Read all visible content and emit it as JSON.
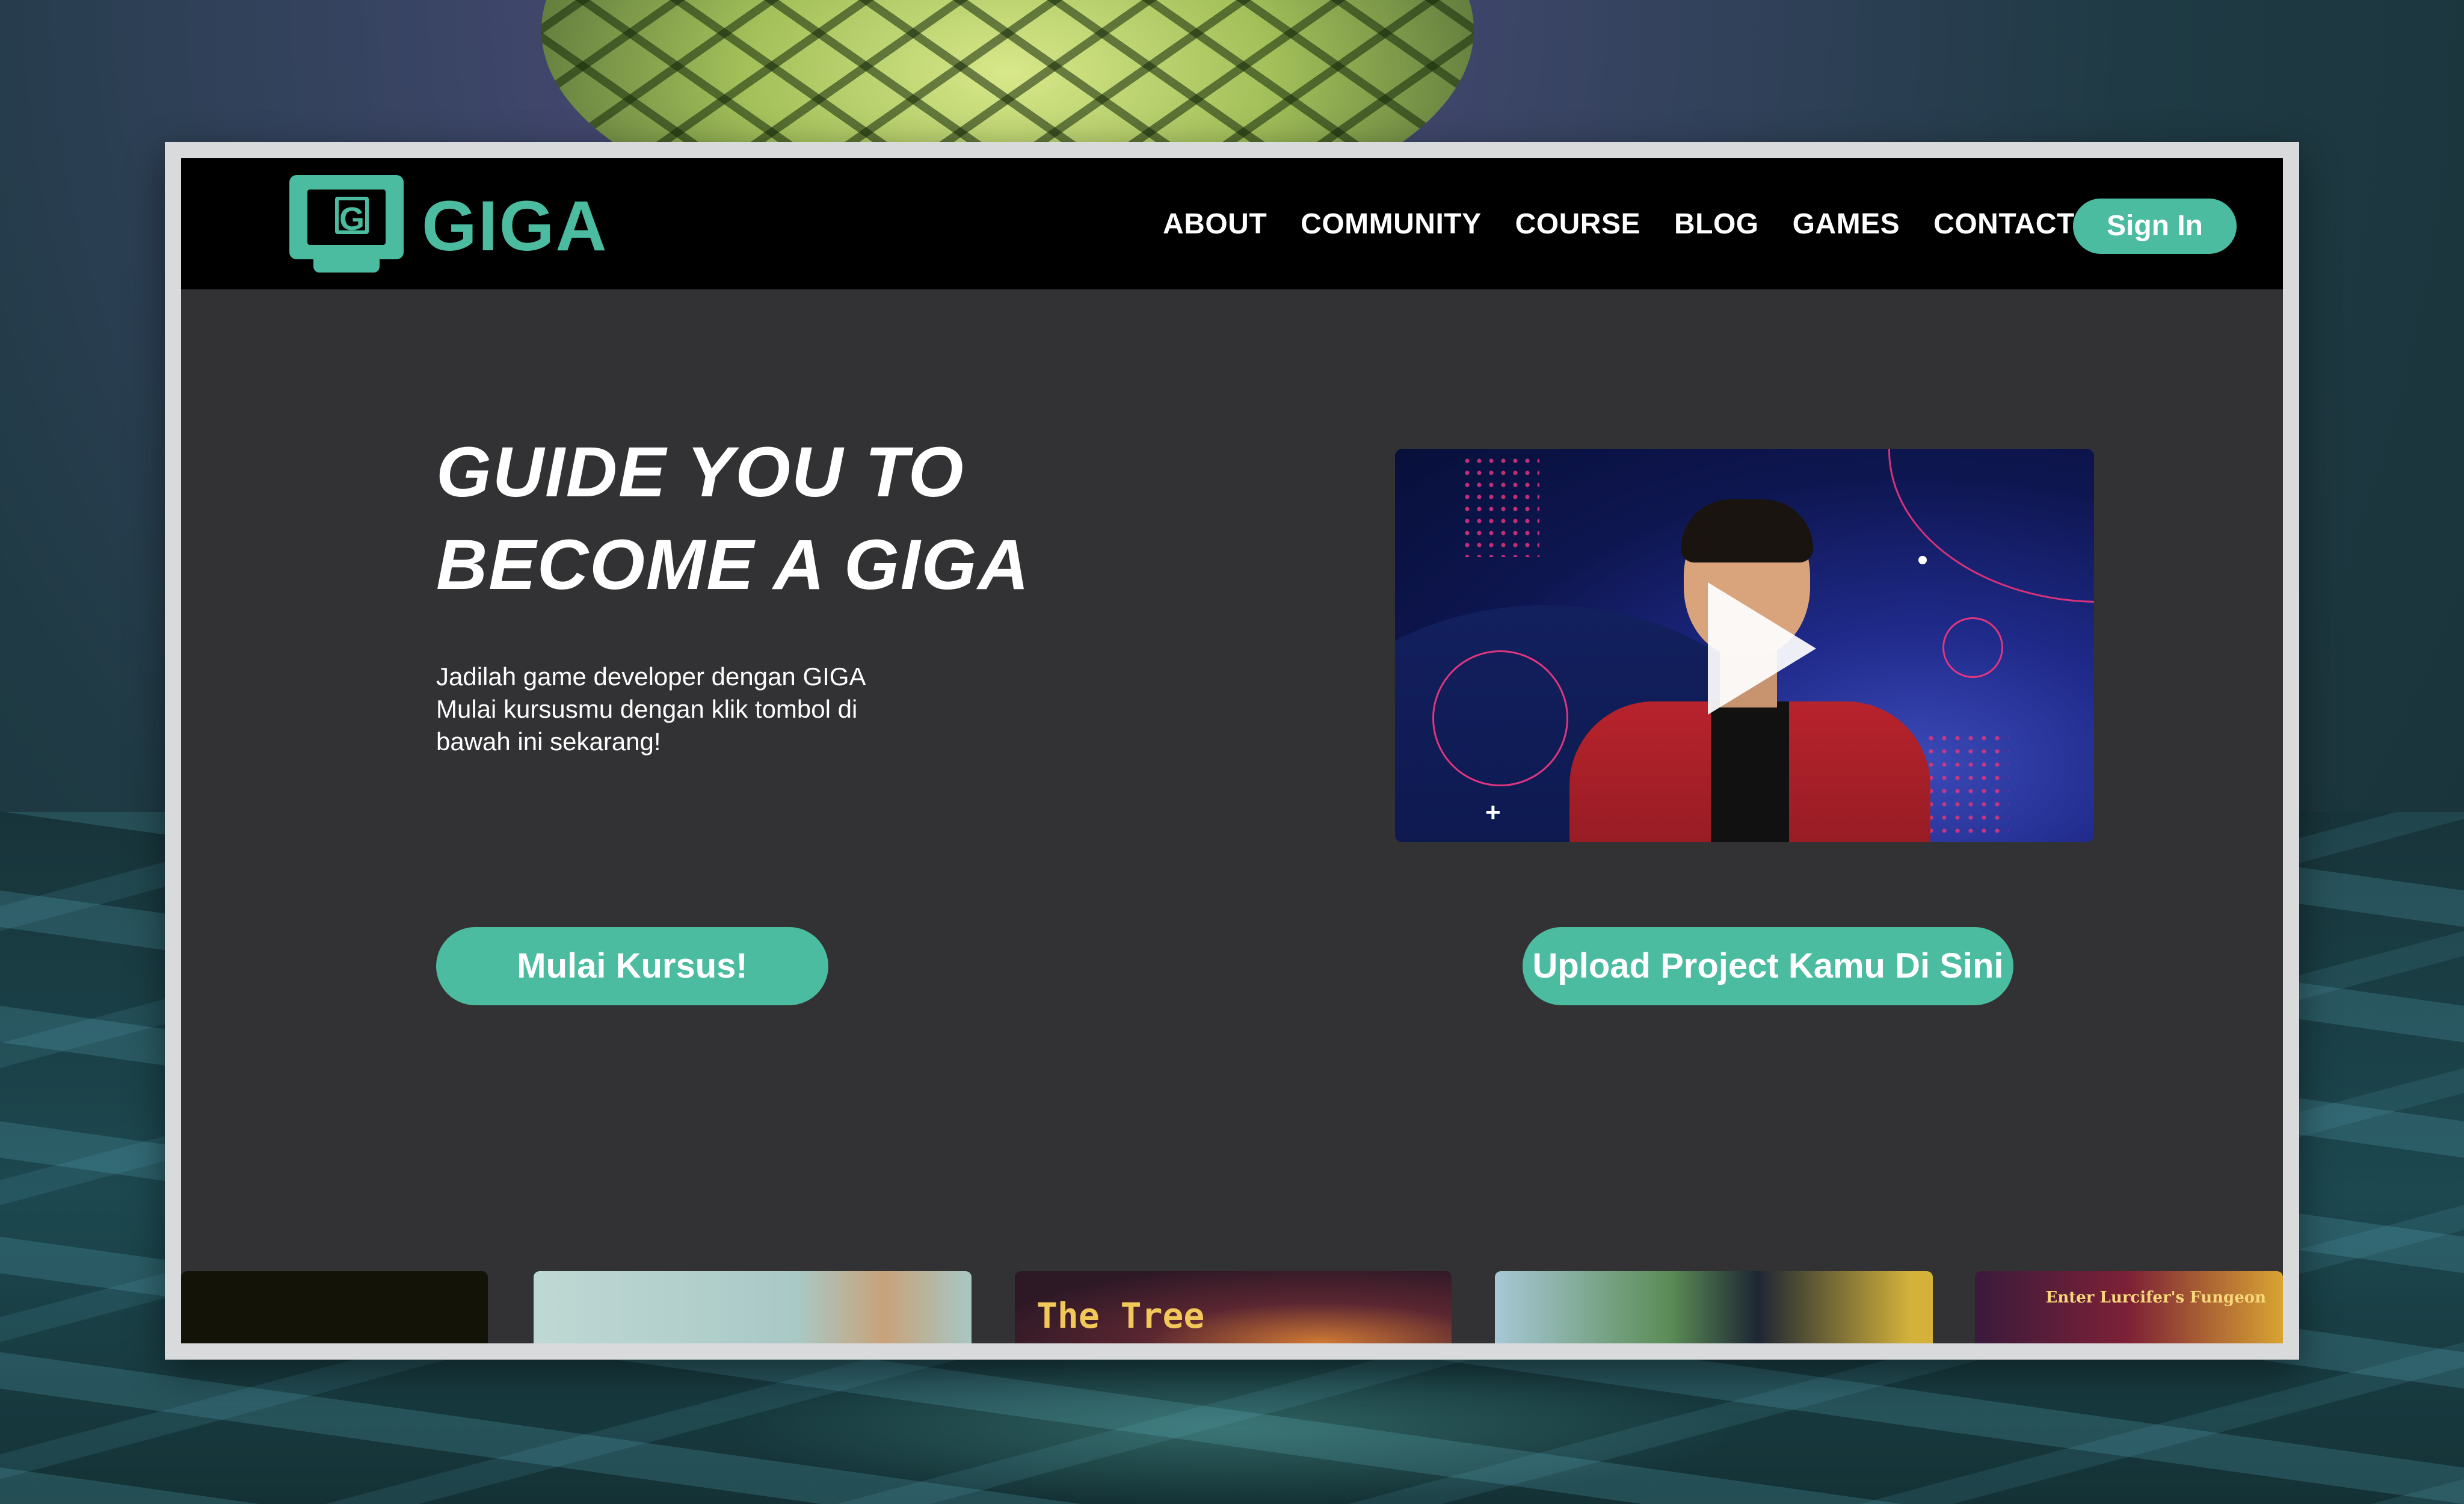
{
  "brand": {
    "logo_letter": "G",
    "name": "GIGA",
    "color": "#4cbca0"
  },
  "nav": {
    "items": [
      "ABOUT",
      "COMMUNITY",
      "COURSE",
      "BLOG",
      "GAMES",
      "CONTACT"
    ],
    "sign_in_label": "Sign In"
  },
  "hero": {
    "title_lines": [
      "GUIDE YOU TO",
      "BECOME A GIGA"
    ],
    "description_lines": [
      "Jadilah game developer dengan GIGA",
      "Mulai kursusmu dengan klik tombol di",
      "bawah ini sekarang!"
    ],
    "video_play_icon": "play-icon"
  },
  "actions": {
    "start_course_label": "Mulai Kursus!",
    "upload_project_label": "Upload Project Kamu Di Sini"
  },
  "games": {
    "thumbnail_titles": [
      "",
      "",
      "The Tree",
      "",
      "Enter Lurcifer's Fungeon"
    ]
  },
  "colors": {
    "navbar": "#000000",
    "page_background": "#323234",
    "accent": "#4cbca0",
    "text": "#ffffff"
  }
}
